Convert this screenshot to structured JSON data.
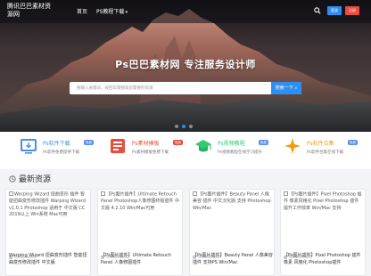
{
  "topbar": {
    "logo_text": "腾讯巴巴素材资源网",
    "nav": {
      "home": "首页",
      "downloads": "PS教程下载"
    },
    "login_label": "登录",
    "register_label": "注册"
  },
  "hero": {
    "title": "Ps巴巴素材网 专注服务设计师",
    "search_placeholder": "搜输入关键词，按回车键搜索您需要的资源",
    "search_button": "搜索一下",
    "slides_count": 3,
    "active_slide": 1
  },
  "features": [
    {
      "title": "Ps软件下载",
      "badge": "免费",
      "badge_color": "#5b8def",
      "desc": "Ps软件免费提供下载",
      "icon": "download-icon",
      "color": "#4a90e2"
    },
    {
      "title": "Ps素材模板",
      "badge": "免费",
      "badge_color": "#e74c3c",
      "desc": "Ps素材模板免费下载",
      "icon": "template-icon",
      "color": "#e74c3c"
    },
    {
      "title": "Ps视频教程",
      "badge": "免费",
      "badge_color": "#5b8def",
      "desc": "Ps视频教程在线学习提升",
      "icon": "graduation-cap-icon",
      "color": "#2ecc71"
    },
    {
      "title": "Ps软件合集",
      "badge": "免费",
      "badge_color": "#5b8def",
      "desc": "Ps软件合集在线下载",
      "icon": "sparkle-icon",
      "color": "#f39c12"
    }
  ],
  "section": {
    "title": "最新资源"
  },
  "cards": [
    {
      "img_alt": "Warping Wizard 扭曲变形 插件 智能扭曲变形修改插件 Warping Wizard v1.0.1 Photoshop 适用于 中文版 CC 2019以上 Win系统 Mac可用",
      "title": "Warping Wizard 扭曲变形插件 智能扭曲变形修改插件 中文版"
    },
    {
      "img_alt": "【Ps图片插件】Ultimate Retouch Panel Photoshop人像修图终极插件 中文版 4.2.10 Win/Mac可用",
      "title": "【Ps图片插件】Ultimate Retouch Panel 人像修图插件"
    },
    {
      "img_alt": "【Ps图片插件】Beauty Panel 人像美容 插件 中文汉化版 支持 Photoshop Win/Mac",
      "title": "【Ps图片插件】Beauty Panel 人像美容插件 支持PS Win/Mac"
    },
    {
      "img_alt": "【Ps图片插件】Pixel Photoshop 插件 像素风格化 Pixel Photoshop 插件 提升工作效率 Win/Mac 支持",
      "title": "【Ps图片插件】Pixel Photoshop 插件 像素 风格化 Photoshop插件"
    }
  ]
}
